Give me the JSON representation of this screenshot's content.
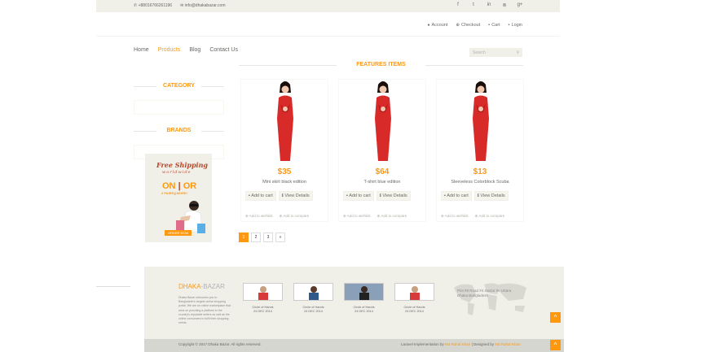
{
  "topbar": {
    "phone": "+88016766261196",
    "email": "info@dhakabazar.com",
    "social_icons": [
      "facebook-icon",
      "twitter-icon",
      "linkedin-icon",
      "dribbble-icon",
      "google-plus-icon"
    ],
    "social_glyphs": [
      "f",
      "t",
      "in",
      "⊚",
      "g+"
    ]
  },
  "shop_menu": [
    {
      "icon": "user-icon",
      "glyph": "👤",
      "label": "Account"
    },
    {
      "icon": "crosshairs-icon",
      "glyph": "⊕",
      "label": "Checkout"
    },
    {
      "icon": "cart-icon",
      "glyph": "🛒",
      "label": "Cart"
    },
    {
      "icon": "lock-icon",
      "glyph": "🔒",
      "label": "Login"
    }
  ],
  "main_menu": [
    {
      "label": "Home"
    },
    {
      "label": "Products"
    },
    {
      "label": "Blog"
    },
    {
      "label": "Contact Us"
    }
  ],
  "search": {
    "placeholder": "Search"
  },
  "sidebar": {
    "category_title": "CATEGORY",
    "brands_title": "BRANDS"
  },
  "shipping_ad": {
    "line1": "Free Shipping",
    "line2": "worldwide",
    "on": "ON",
    "or": "OR",
    "pairs": "2 PAIRS",
    "more": "MORE!",
    "button": "ORDER NOW"
  },
  "features_title": "FEATURES ITEMS",
  "products": [
    {
      "price": "$35",
      "name": "Mini skirt black edition",
      "add": "Add to cart",
      "view": "View Details",
      "wishlist": "Add to wishlist",
      "compare": "Add to compare"
    },
    {
      "price": "$64",
      "name": "T-shirt blue edition",
      "add": "Add to cart",
      "view": "View Details",
      "wishlist": "Add to wishlist",
      "compare": "Add to compare"
    },
    {
      "price": "$13",
      "name": "Sleeveless Colorblock Scuba",
      "add": "Add to cart",
      "view": "View Details",
      "wishlist": "Add to wishlist",
      "compare": "Add to compare"
    }
  ],
  "pagination": [
    "1",
    "2",
    "3",
    "»"
  ],
  "footer": {
    "brand_part1": "DHAKA",
    "brand_part2": "-BAZAR",
    "description": "Dhaka Bazar welcomes you to Bangladesh's largest online shopping portal. We are an online marketplace that aims on providing a platform to the country's reputable sellers as well as the online consumers to fulfil their shopping needs.",
    "videos": [
      {
        "title": "Circle of Hands",
        "date": "24 DEC 2014"
      },
      {
        "title": "Circle of Hands",
        "date": "24 DEC 2014"
      },
      {
        "title": "Circle of Hands",
        "date": "24 DEC 2014"
      },
      {
        "title": "Circle of Hands",
        "date": "24 DEC 2014"
      }
    ],
    "address_line1": "Plot #8 Road #4 Sector #6 Uttara",
    "address_line2": "Dhaka Bangladesh",
    "copyright": "Copyright © 2017 Dhaka Bazar. All rights reserved.",
    "credit_prefix": "Laravel Implementation by ",
    "credit_name1": "Md Rahat Khan",
    "credit_mid": " | Designed by ",
    "credit_name2": "Md Rahat Khan"
  },
  "colors": {
    "accent": "#fe980f",
    "bar": "#f0f0e9"
  }
}
